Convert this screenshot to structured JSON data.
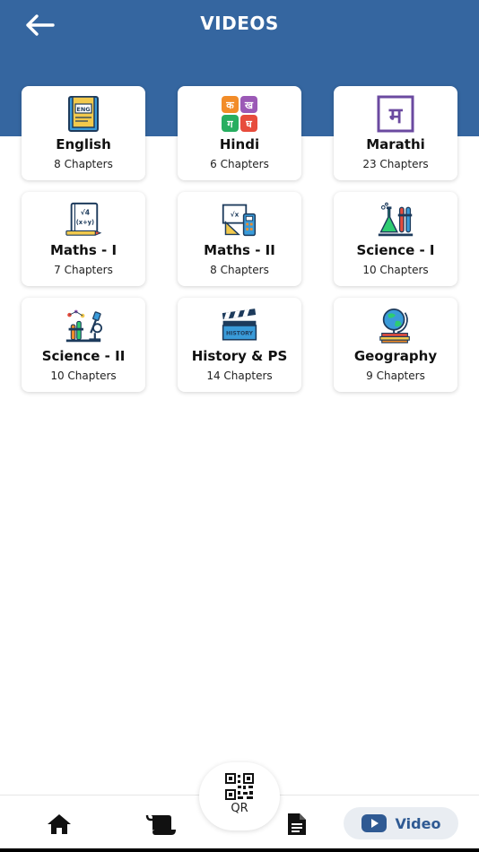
{
  "header": {
    "title": "VIDEOS",
    "back_icon": "arrow-left-icon",
    "color": "#3566a0"
  },
  "subjects": [
    {
      "name": "English",
      "chapters": "8 Chapters",
      "icon": "english-book-icon"
    },
    {
      "name": "Hindi",
      "chapters": "6 Chapters",
      "icon": "hindi-letters-icon"
    },
    {
      "name": "Marathi",
      "chapters": "23 Chapters",
      "icon": "marathi-letter-icon"
    },
    {
      "name": "Maths - I",
      "chapters": "7 Chapters",
      "icon": "math-notebook-icon"
    },
    {
      "name": "Maths - II",
      "chapters": "8 Chapters",
      "icon": "geometry-tools-icon"
    },
    {
      "name": "Science - I",
      "chapters": "10 Chapters",
      "icon": "lab-flask-icon"
    },
    {
      "name": "Science - II",
      "chapters": "10 Chapters",
      "icon": "microscope-icon"
    },
    {
      "name": "History & PS",
      "chapters": "14 Chapters",
      "icon": "clapperboard-icon"
    },
    {
      "name": "Geography",
      "chapters": "9 Chapters",
      "icon": "globe-icon"
    }
  ],
  "bottom_nav": {
    "qr_label": "QR",
    "video_label": "Video",
    "active_color": "#2f5a93"
  }
}
